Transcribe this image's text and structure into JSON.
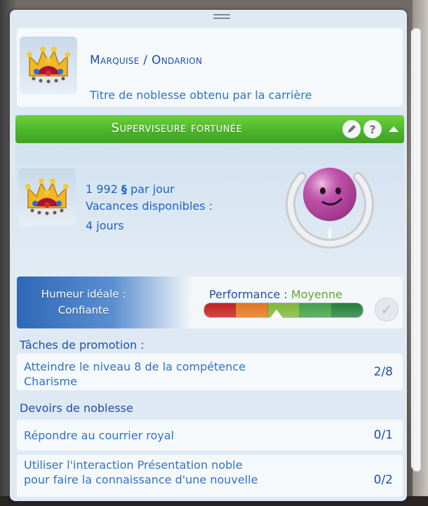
{
  "title": {
    "name": "Marquise / Ondarion",
    "description": "Titre de noblesse obtenu par la carrière"
  },
  "career": {
    "title": "Superviseure fortunée",
    "edit_icon": "pencil-icon",
    "help_label": "?",
    "collapse_icon": "caret-up-icon"
  },
  "stats": {
    "salary": "1 992",
    "salary_icon": "simoleon-icon",
    "salary_unit": "par jour",
    "vacation_label": "Vacances disponibles :",
    "vacation_value": "4 jours"
  },
  "mood": {
    "label": "Humeur idéale :",
    "value": "Confiante",
    "face_icon": "confident-mood-face-icon"
  },
  "performance": {
    "label": "Performance :",
    "value": "Moyenne",
    "level_fraction": 0.46,
    "segment_colors": [
      "#c3201c",
      "#e2761e",
      "#7eb83a",
      "#3fa046",
      "#24803a"
    ]
  },
  "promotion": {
    "heading": "Tâches de promotion :",
    "tasks": [
      {
        "line1": "Atteindre le niveau 8  de la compétence",
        "line2": "Charisme",
        "count": "2/8"
      }
    ]
  },
  "duties": {
    "heading": "Devoirs de noblesse",
    "items": [
      {
        "line1": "Répondre au courrier royal",
        "line2": "",
        "count": "0/1"
      },
      {
        "line1": "Utiliser l'interaction Présentation noble",
        "line2": "pour faire la connaissance d'une nouvelle",
        "count": "0/2"
      }
    ]
  },
  "colors": {
    "accent_green": "#4cb52a",
    "text_blue": "#1f4fa8",
    "mood_purple": "#b5469f"
  }
}
